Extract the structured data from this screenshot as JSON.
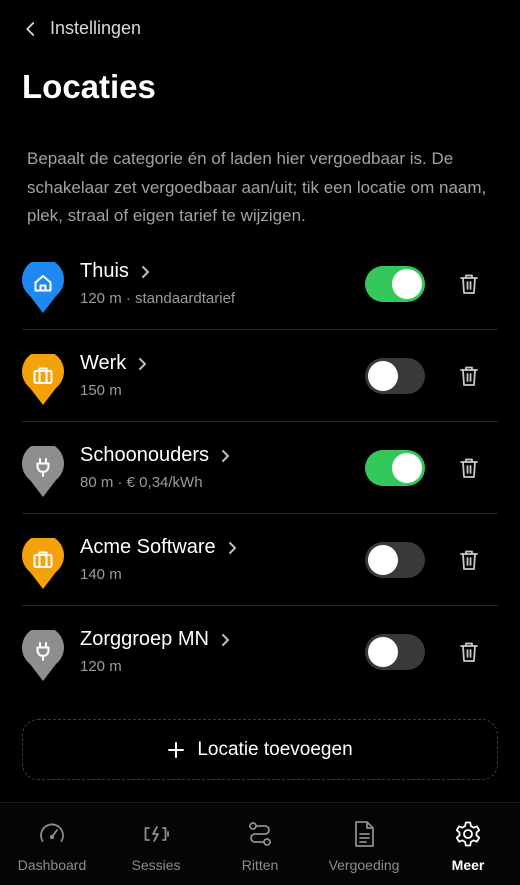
{
  "header": {
    "back_label": "Instellingen",
    "title": "Locaties",
    "description": "Bepaalt de categorie én of laden hier vergoedbaar is. De schakelaar zet vergoedbaar aan/uit; tik een locatie om naam, plek, straal of eigen tarief te wijzigen."
  },
  "colors": {
    "home": "#1e88f5",
    "work": "#f5a10a",
    "other": "#8e8e8e",
    "toggle_on": "#34c759",
    "toggle_off": "#3a3a3a"
  },
  "locations": [
    {
      "name": "Thuis",
      "detail": "120 m · standaardtarief",
      "icon": "home-icon",
      "enabled": true
    },
    {
      "name": "Werk",
      "detail": "150 m",
      "icon": "briefcase-icon",
      "enabled": false
    },
    {
      "name": "Schoonouders",
      "detail": "80 m · € 0,34/kWh",
      "icon": "plug-icon",
      "enabled": true
    },
    {
      "name": "Acme Software",
      "detail": "140 m",
      "icon": "briefcase-icon",
      "enabled": false
    },
    {
      "name": "Zorggroep MN",
      "detail": "120 m",
      "icon": "plug-icon",
      "enabled": false
    }
  ],
  "add_button": {
    "label": "Locatie toevoegen"
  },
  "tabbar": {
    "tabs": [
      {
        "label": "Dashboard",
        "icon": "speedometer-icon",
        "active": false
      },
      {
        "label": "Sessies",
        "icon": "charging-icon",
        "active": false
      },
      {
        "label": "Ritten",
        "icon": "route-icon",
        "active": false
      },
      {
        "label": "Vergoeding",
        "icon": "document-icon",
        "active": false
      },
      {
        "label": "Meer",
        "icon": "gear-icon",
        "active": true
      }
    ]
  }
}
